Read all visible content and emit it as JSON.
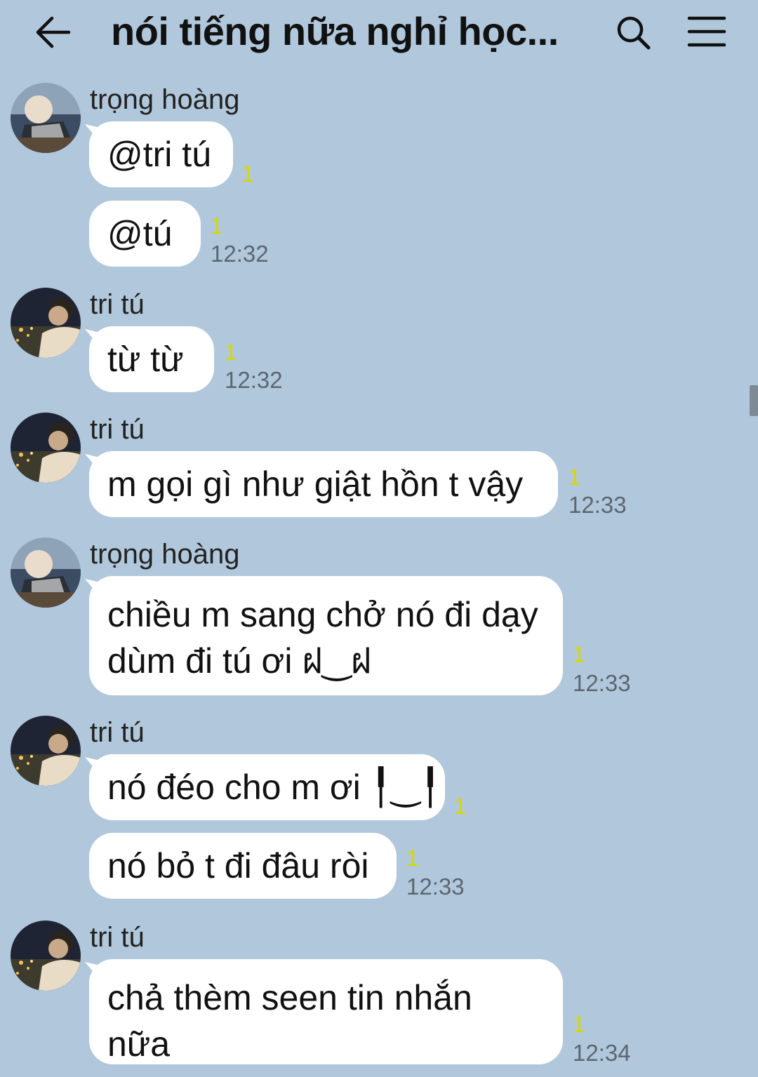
{
  "header": {
    "title": "nói tiếng nữa nghỉ học...",
    "back_icon": "arrow-left-icon",
    "search_icon": "search-icon",
    "menu_icon": "hamburger-menu-icon"
  },
  "messages": [
    {
      "sender": "trọng hoàng",
      "text": "@tri tú",
      "read": "1"
    },
    {
      "text": "@tú",
      "read": "1",
      "time": "12:32"
    },
    {
      "sender": "tri tú",
      "text": "từ từ",
      "read": "1",
      "time": "12:32"
    },
    {
      "sender": "tri tú",
      "text": "m gọi gì như giật hồn t vậy",
      "read": "1",
      "time": "12:33"
    },
    {
      "sender": "trọng hoàng",
      "text": "chiều m sang chở nó đi dạy dùm đi tú ơi ฝ‿ฝ",
      "read": "1",
      "time": "12:33"
    },
    {
      "sender": "tri tú",
      "text": "nó đéo cho m ơi ╿‿╿",
      "read": "1"
    },
    {
      "text": "nó bỏ t đi đâu ròi",
      "read": "1",
      "time": "12:33"
    },
    {
      "sender": "tri tú",
      "text": "chả thèm seen tin nhắn nữa",
      "read": "1",
      "time": "12:34"
    }
  ],
  "colors": {
    "background": "#b1c8dc",
    "bubble": "#ffffff",
    "read_indicator": "#d7d800",
    "timestamp": "#5b6670"
  }
}
